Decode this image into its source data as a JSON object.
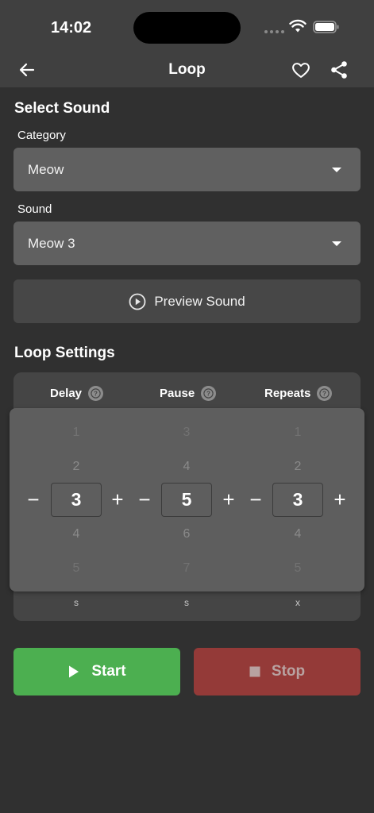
{
  "status": {
    "time": "14:02"
  },
  "nav": {
    "title": "Loop"
  },
  "select_sound": {
    "heading": "Select Sound",
    "category_label": "Category",
    "category_value": "Meow",
    "sound_label": "Sound",
    "sound_value": "Meow 3",
    "preview_label": "Preview Sound"
  },
  "loop_settings": {
    "heading": "Loop Settings",
    "columns": [
      {
        "title": "Delay",
        "value": "3",
        "above": [
          "1",
          "2"
        ],
        "below": [
          "4",
          "5"
        ],
        "unit": "s"
      },
      {
        "title": "Pause",
        "value": "5",
        "above": [
          "3",
          "4"
        ],
        "below": [
          "6",
          "7"
        ],
        "unit": "s"
      },
      {
        "title": "Repeats",
        "value": "3",
        "above": [
          "1",
          "2"
        ],
        "below": [
          "4",
          "5"
        ],
        "unit": "x"
      }
    ],
    "minus": "−",
    "plus": "+"
  },
  "actions": {
    "start_label": "Start",
    "stop_label": "Stop"
  },
  "colors": {
    "start": "#4caf50",
    "stop": "#943a38",
    "background": "#303030"
  },
  "icons": [
    "back-arrow-icon",
    "heart-icon",
    "share-icon",
    "play-circle-icon",
    "help-icon",
    "play-icon",
    "stop-square-icon",
    "wifi-icon",
    "battery-icon"
  ]
}
